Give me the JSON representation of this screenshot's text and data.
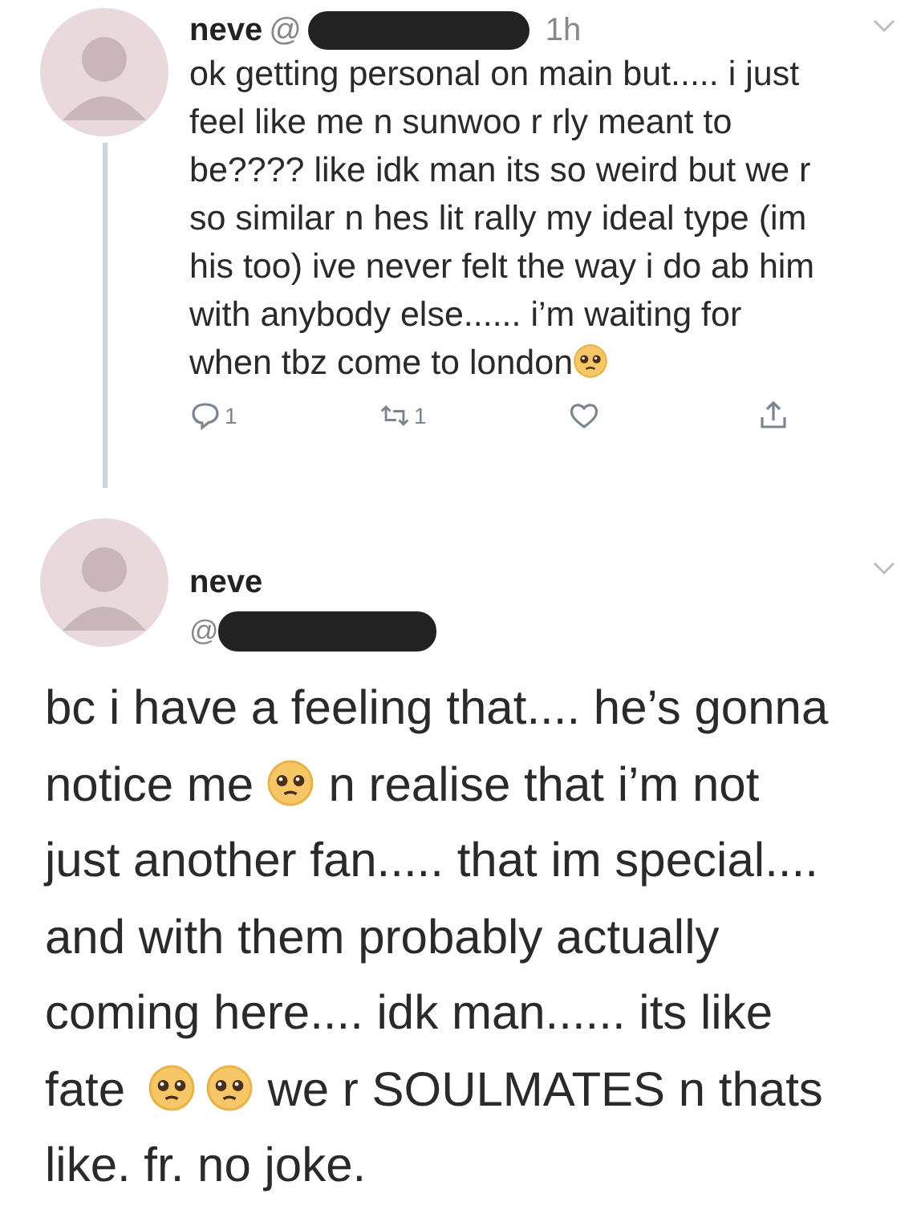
{
  "tweets": [
    {
      "name": "neve",
      "handle_prefix": "@",
      "time": "1h",
      "body": [
        {
          "kind": "text",
          "text": "ok getting personal on main but..... i just\nfeel like me n sunwoo r rly meant to\nbe???? like idk man its so weird but we r\nso similar n hes lit rally my ideal type (im\nhis too) ive never felt the way i do ab him\nwith anybody else...... i’m waiting for\nwhen tbz come to london"
        },
        {
          "kind": "emoji"
        }
      ],
      "actions": [
        {
          "kind": "reply",
          "count": "1"
        },
        {
          "kind": "retweet",
          "count": "1"
        },
        {
          "kind": "like"
        },
        {
          "kind": "share"
        }
      ]
    },
    {
      "name": "neve",
      "handle_prefix": "@",
      "body": [
        {
          "kind": "text",
          "text": "bc i have a feeling that.... he’s gonna\nnotice me "
        },
        {
          "kind": "emoji"
        },
        {
          "kind": "text",
          "text": " n realise that i’m not\njust another fan..... that im special....\nand with them probably actually\ncoming here.... idk man...... its like\nfate "
        },
        {
          "kind": "emoji"
        },
        {
          "kind": "emoji"
        },
        {
          "kind": "text",
          "text": " we r SOULMATES n thats\nlike. fr. no joke."
        }
      ]
    }
  ]
}
